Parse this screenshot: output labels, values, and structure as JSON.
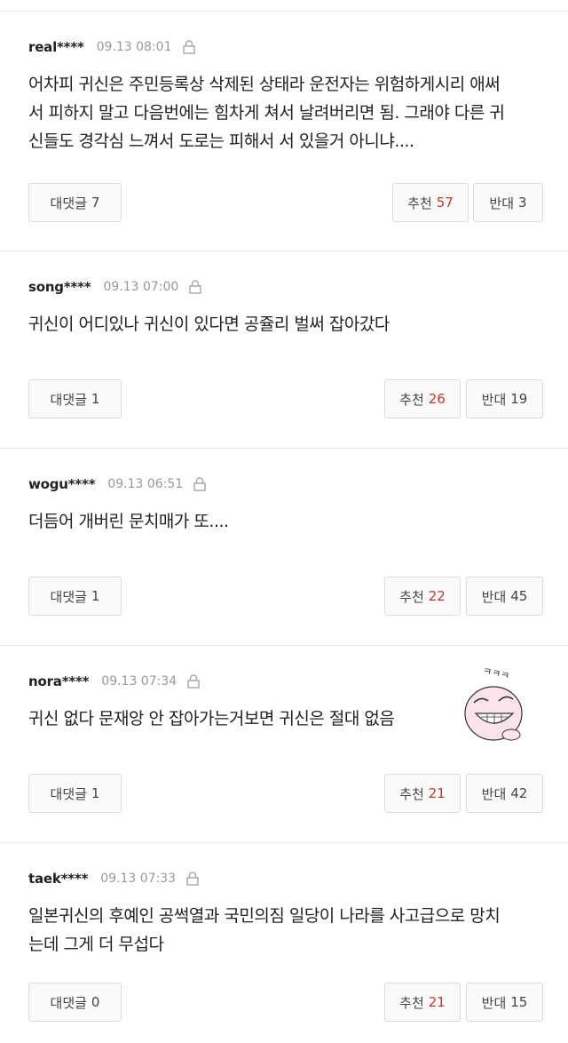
{
  "comments": [
    {
      "user": "real****",
      "date": "09.13 08:01",
      "text": "어차피 귀신은 주민등록상 삭제된 상태라 운전자는 위험하게시리 애써\n서 피하지 말고 다음번에는 힘차게 쳐서 날려버리면 됨. 그래야 다른 귀\n신들도 경각심 느껴서 도로는 피해서 서 있을거 아니냐....",
      "reply_label": "대댓글",
      "reply_count": "7",
      "like_label": "추천",
      "like_count": "57",
      "dislike_label": "반대",
      "dislike_count": "3"
    },
    {
      "user": "song****",
      "date": "09.13 07:00",
      "text": "귀신이 어디있나 귀신이 있다면 공쥴리 벌써 잡아갔다",
      "reply_label": "대댓글",
      "reply_count": "1",
      "like_label": "추천",
      "like_count": "26",
      "dislike_label": "반대",
      "dislike_count": "19"
    },
    {
      "user": "wogu****",
      "date": "09.13 06:51",
      "text": "더듬어 개버린 문치매가 또....",
      "reply_label": "대댓글",
      "reply_count": "1",
      "like_label": "추천",
      "like_count": "22",
      "dislike_label": "반대",
      "dislike_count": "45"
    },
    {
      "user": "nora****",
      "date": "09.13 07:34",
      "text": "귀신 없다 문재앙 안 잡아가는거보면 귀신은 절대 없음",
      "reply_label": "대댓글",
      "reply_count": "1",
      "like_label": "추천",
      "like_count": "21",
      "dislike_label": "반대",
      "dislike_count": "42",
      "sticker_text": "ㅋㅋㅋ"
    },
    {
      "user": "taek****",
      "date": "09.13 07:33",
      "text": "일본귀신의 후예인 공썩열과 국민의짐 일당이 나라를 사고급으로 망치\n는데 그게 더 무섭다",
      "reply_label": "대댓글",
      "reply_count": "0",
      "like_label": "추천",
      "like_count": "21",
      "dislike_label": "반대",
      "dislike_count": "15"
    }
  ]
}
